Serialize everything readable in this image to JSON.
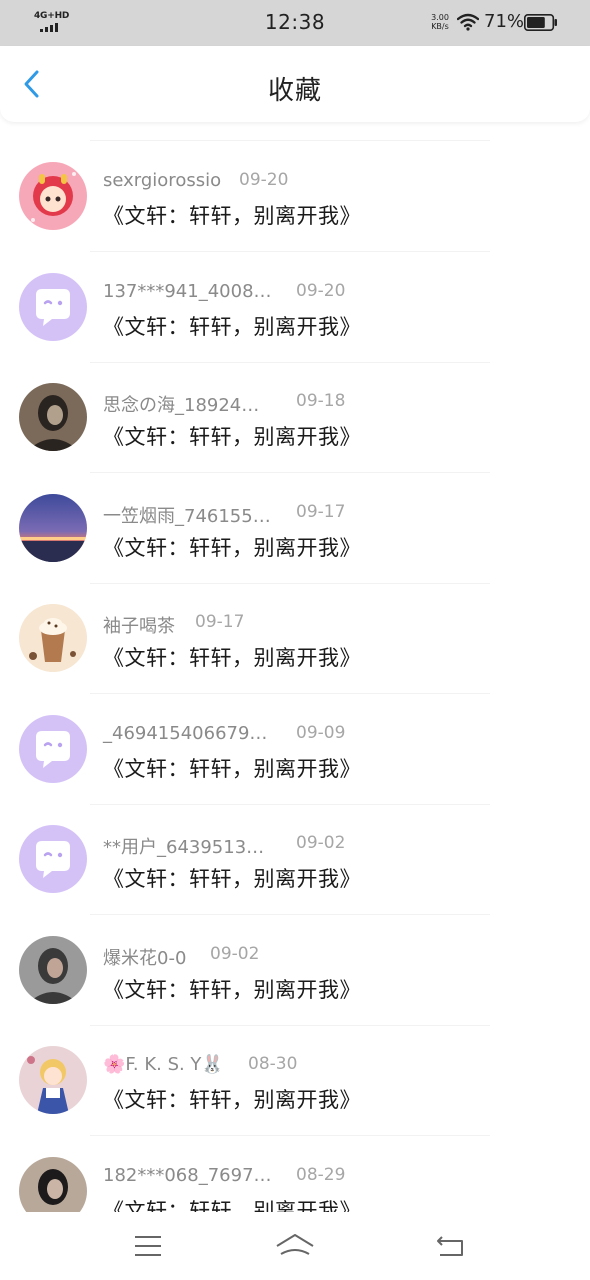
{
  "status_bar": {
    "network": "4G+HD",
    "time": "12:38",
    "speed_value": "3.00",
    "speed_unit": "KB/s",
    "battery": "71%",
    "battery_level": 0.71,
    "icons": [
      "signal-icon",
      "wifi-icon",
      "battery-icon"
    ]
  },
  "header": {
    "title": "收藏",
    "back_icon": "chevron-left-icon",
    "accent_color": "#2f9ae6"
  },
  "items": [
    {
      "username": "sexrgiorossio",
      "date": "09-20",
      "title": "《文轩：轩轩，别离开我》",
      "avatar": "cartoon-girl-avatar"
    },
    {
      "username": "137***941_4008…",
      "date": "09-20",
      "title": "《文轩：轩轩，别离开我》",
      "avatar": "default-chat-avatar"
    },
    {
      "username": "思念の海_18924…",
      "date": "09-18",
      "title": "《文轩：轩轩，别离开我》",
      "avatar": "photo-avatar"
    },
    {
      "username": "一笠烟雨_746155…",
      "date": "09-17",
      "title": "《文轩：轩轩，别离开我》",
      "avatar": "sunset-bridge-avatar"
    },
    {
      "username": "袖子喝茶",
      "date": "09-17",
      "title": "《文轩：轩轩，别离开我》",
      "avatar": "coffee-drink-avatar"
    },
    {
      "username": "_469415406679…",
      "date": "09-09",
      "title": "《文轩：轩轩，别离开我》",
      "avatar": "default-chat-avatar"
    },
    {
      "username": "**用户_6439513…",
      "date": "09-02",
      "title": "《文轩：轩轩，别离开我》",
      "avatar": "default-chat-avatar"
    },
    {
      "username": "爆米花0-0",
      "date": "09-02",
      "title": "《文轩：轩轩，别离开我》",
      "avatar": "photo-avatar"
    },
    {
      "username": "🌸F. K. S. Y🐰",
      "date": "08-30",
      "title": "《文轩：轩轩，别离开我》",
      "avatar": "anime-avatar"
    },
    {
      "username": "182***068_7697…",
      "date": "08-29",
      "title": "《文轩：轩轩，别离开我》",
      "avatar": "photo-avatar"
    }
  ],
  "nav_bar": {
    "menu_icon": "menu-icon",
    "home_icon": "home-icon",
    "back_icon": "back-icon"
  }
}
